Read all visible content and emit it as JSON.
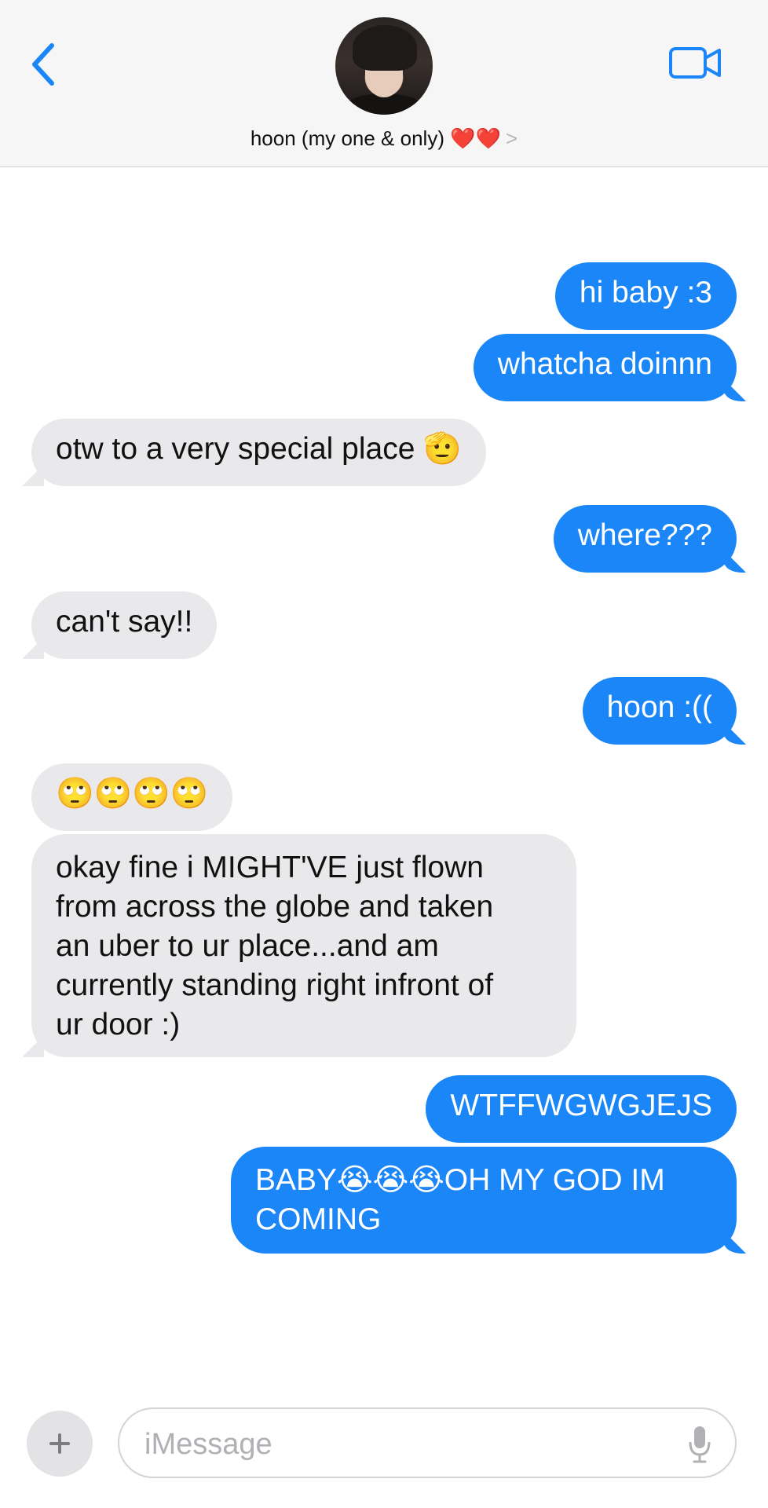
{
  "header": {
    "contact_name": "hoon (my one & only) ❤️❤️",
    "chevron": ">",
    "icons": {
      "back": "chevron-left-icon",
      "video": "video-camera-icon"
    },
    "accent_color": "#1b86f7"
  },
  "messages": [
    {
      "side": "out",
      "text": "hi baby :3"
    },
    {
      "side": "out",
      "text": "whatcha doinnn"
    },
    {
      "side": "in",
      "text": "otw to a very special place 🫡"
    },
    {
      "side": "out",
      "text": "where???"
    },
    {
      "side": "in",
      "text": "can't say!!"
    },
    {
      "side": "out",
      "text": "hoon :(("
    },
    {
      "side": "in",
      "text": "🙄🙄🙄🙄"
    },
    {
      "side": "in",
      "text": "okay fine i MIGHT'VE just flown\nfrom across the globe and taken\nan uber to ur place...and am\ncurrently standing right infront of\nur door :)"
    },
    {
      "side": "out",
      "text": "WTFFWGWGJEJS"
    },
    {
      "side": "out",
      "text": "BABY😭😭😭OH MY GOD IM\nCOMING"
    }
  ],
  "composer": {
    "placeholder": "iMessage",
    "value": "",
    "icons": {
      "plus": "plus-icon",
      "mic": "microphone-icon"
    }
  },
  "colors": {
    "outgoing": "#1b86f7",
    "incoming": "#e9e9eb",
    "header_bg": "#f6f6f6"
  }
}
